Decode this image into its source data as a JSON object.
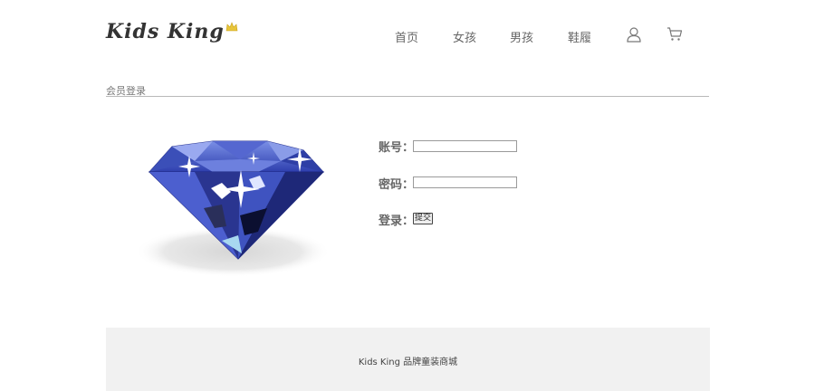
{
  "header": {
    "logo_text": "Kids King",
    "nav": [
      "首页",
      "女孩",
      "男孩",
      "鞋履"
    ],
    "icons": [
      "user-icon",
      "cart-icon"
    ]
  },
  "section": {
    "title": "会员登录"
  },
  "form": {
    "account_label": "账号：",
    "password_label": "密码：",
    "login_label": "登录：",
    "account_value": "",
    "password_value": "",
    "submit_label": "提交"
  },
  "footer": {
    "text": "Kids King 品牌童装商城"
  },
  "colors": {
    "divider": "#b9b9b9",
    "footer_bg": "#f1f1f1",
    "diamond_blue": "#3b4fb8",
    "crown_gold": "#e8c53a"
  }
}
